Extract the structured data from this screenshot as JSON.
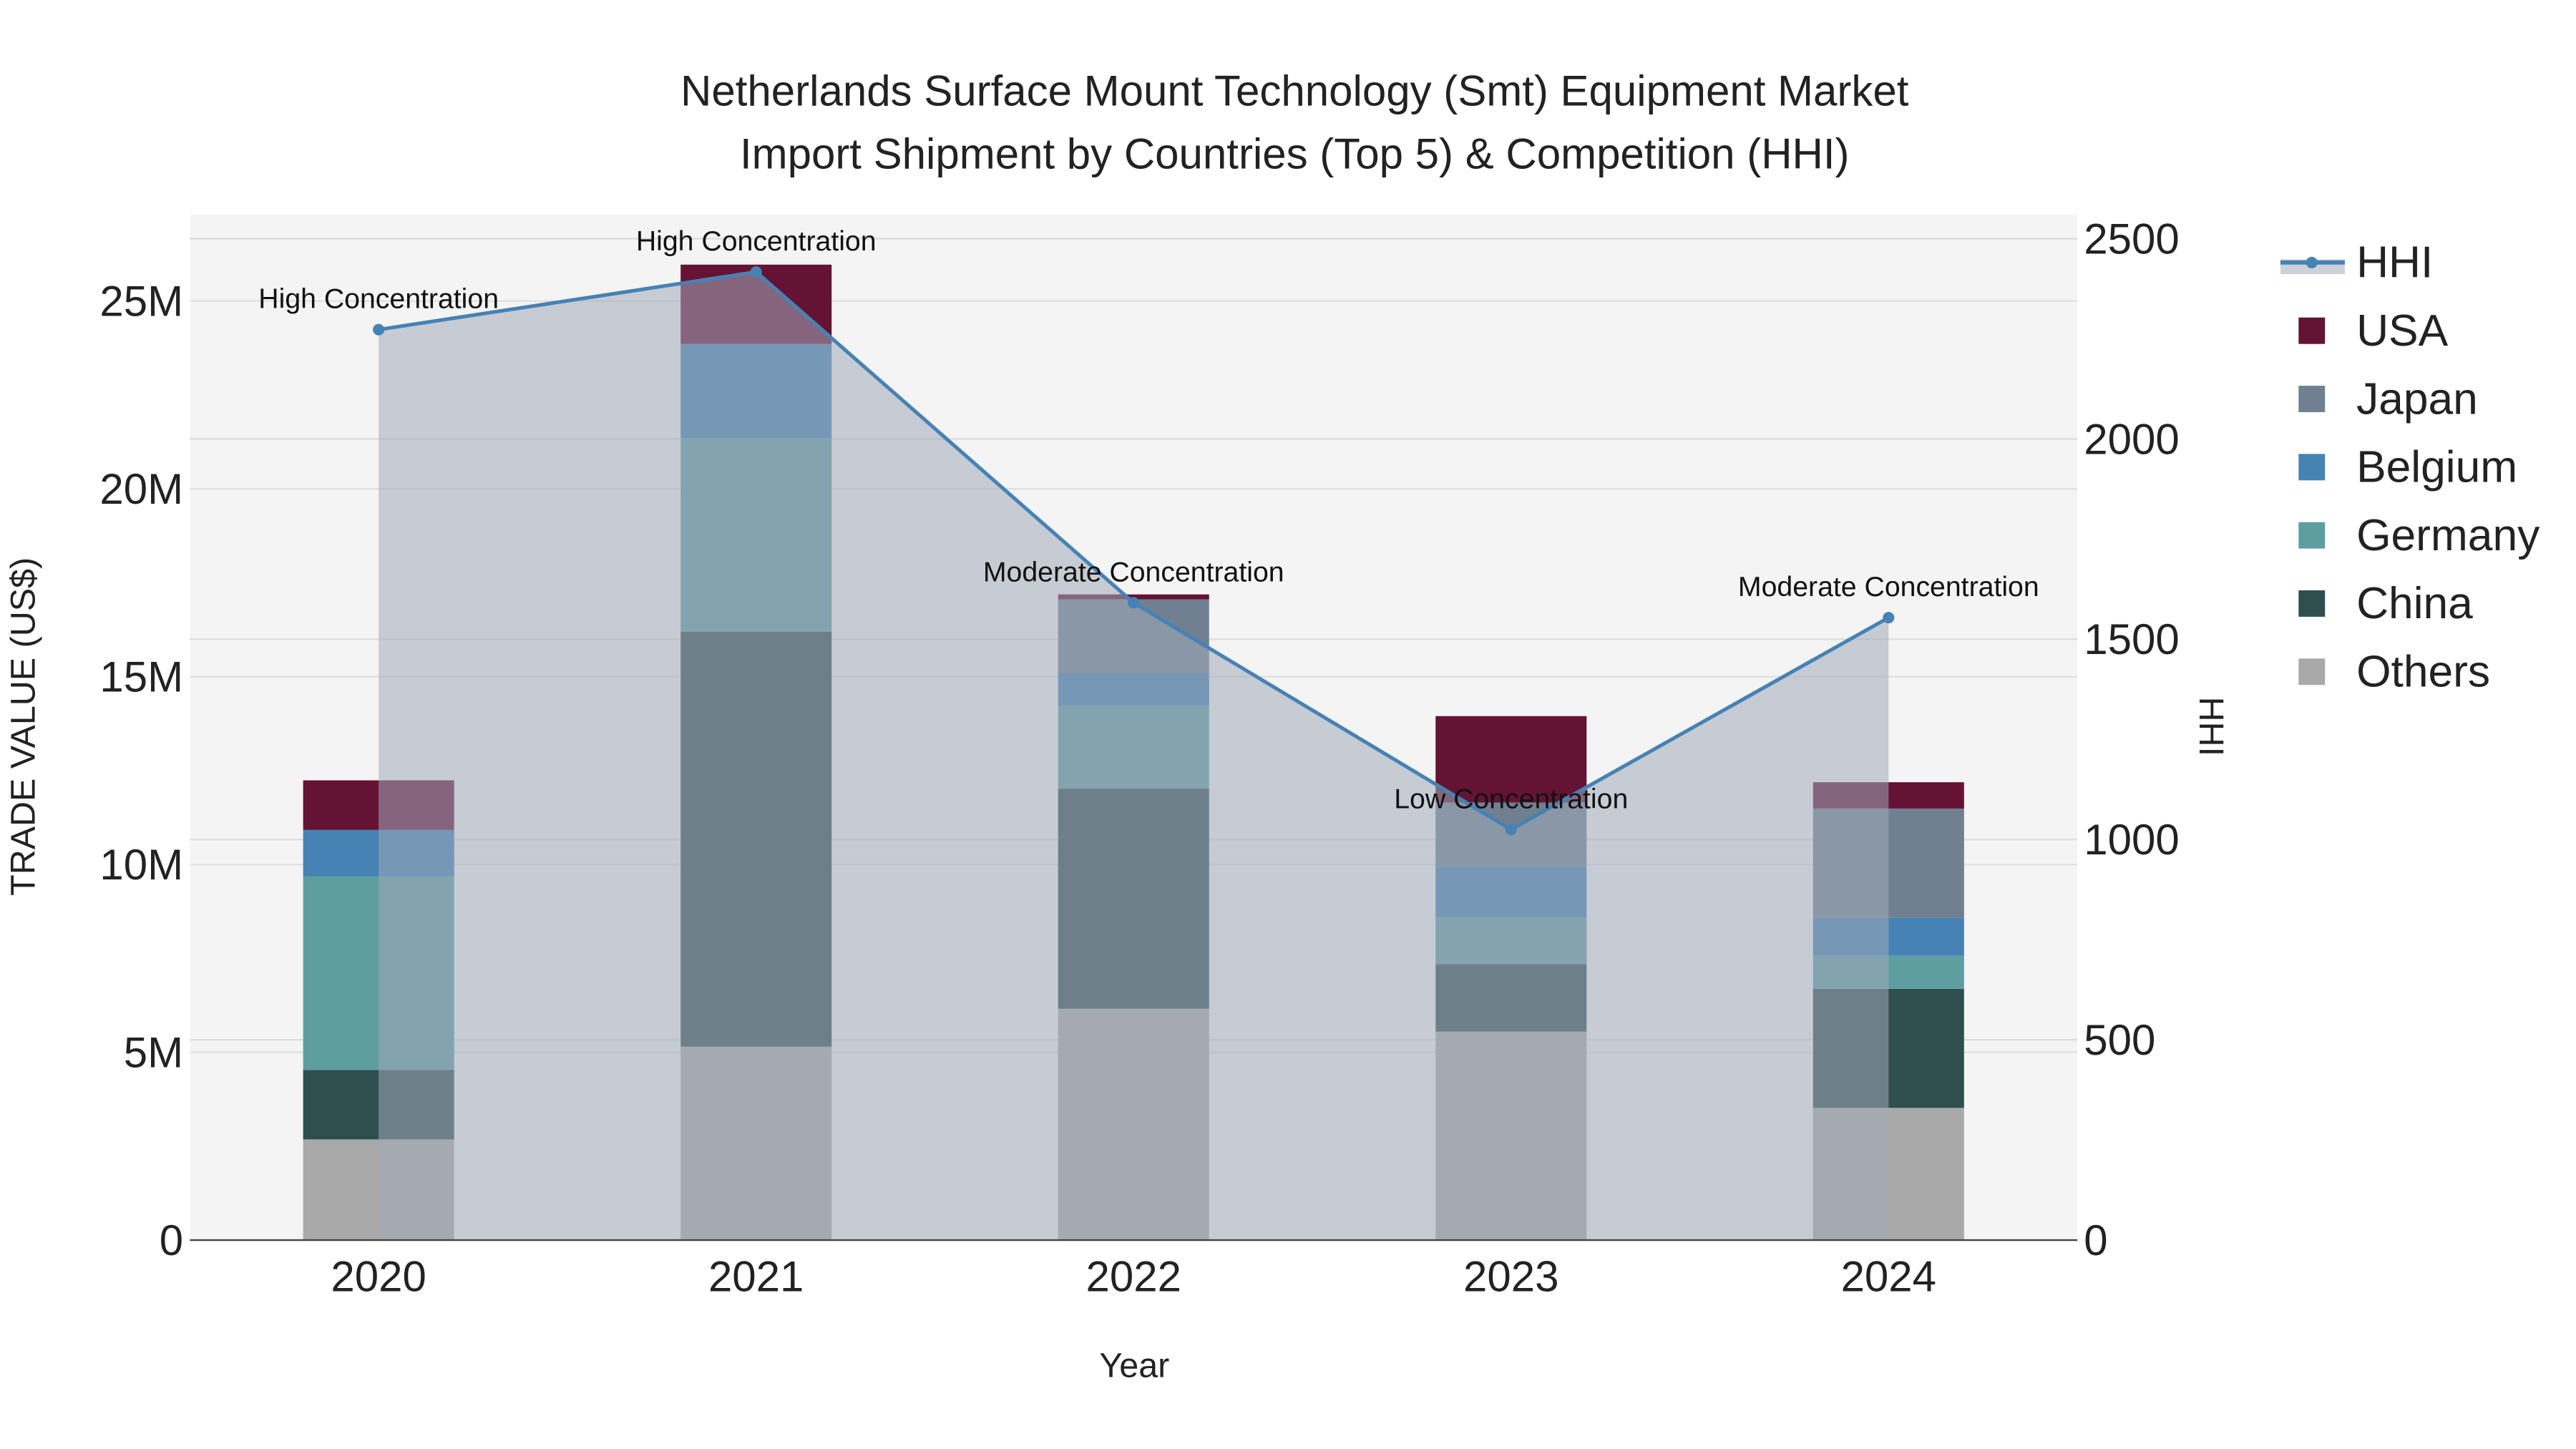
{
  "chart_data": {
    "type": "bar",
    "title_line1": "Netherlands Surface Mount Technology (Smt) Equipment Market",
    "title_line2": "Import Shipment by Countries (Top 5) & Competition (HHI)",
    "xlabel": "Year",
    "ylabel": "TRADE VALUE (US$)",
    "y2label": "HHI",
    "categories": [
      "2020",
      "2021",
      "2022",
      "2023",
      "2024"
    ],
    "ylim": [
      0,
      27300000
    ],
    "y2lim": [
      0,
      2560
    ],
    "yticks": [
      0,
      5000000,
      10000000,
      15000000,
      20000000,
      25000000
    ],
    "ytick_labels": [
      "0",
      "5M",
      "10M",
      "15M",
      "20M",
      "25M"
    ],
    "y2ticks": [
      0,
      500,
      1000,
      1500,
      2000,
      2500
    ],
    "y2tick_labels": [
      "0",
      "500",
      "1000",
      "1500",
      "2000",
      "2500"
    ],
    "grid": true,
    "legend_position": "right",
    "series": [
      {
        "name": "Others",
        "color": "#a9a9a9",
        "values": [
          2680000,
          5150000,
          6160000,
          5550000,
          3520000
        ]
      },
      {
        "name": "China",
        "color": "#2f4f4f",
        "values": [
          1850000,
          11050000,
          5860000,
          1800000,
          3170000
        ]
      },
      {
        "name": "Germany",
        "color": "#5f9ea0",
        "values": [
          5150000,
          5150000,
          2200000,
          1250000,
          880000
        ]
      },
      {
        "name": "Belgium",
        "color": "#4682b4",
        "values": [
          1240000,
          2510000,
          880000,
          1350000,
          1010000
        ]
      },
      {
        "name": "Japan",
        "color": "#708090",
        "values": [
          0,
          0,
          1960000,
          1700000,
          2910000
        ]
      },
      {
        "name": "USA",
        "color": "#641334",
        "values": [
          1320000,
          2110000,
          130000,
          2300000,
          700000
        ]
      }
    ],
    "hhi": {
      "name": "HHI",
      "color": "#4682b4",
      "values": [
        2273,
        2417,
        1591,
        1025,
        1554
      ],
      "annotations": [
        "High Concentration",
        "High Concentration",
        "Moderate Concentration",
        "Low Concentration",
        "Moderate Concentration"
      ]
    },
    "legend_order": [
      "HHI",
      "USA",
      "Japan",
      "Belgium",
      "Germany",
      "China",
      "Others"
    ]
  }
}
